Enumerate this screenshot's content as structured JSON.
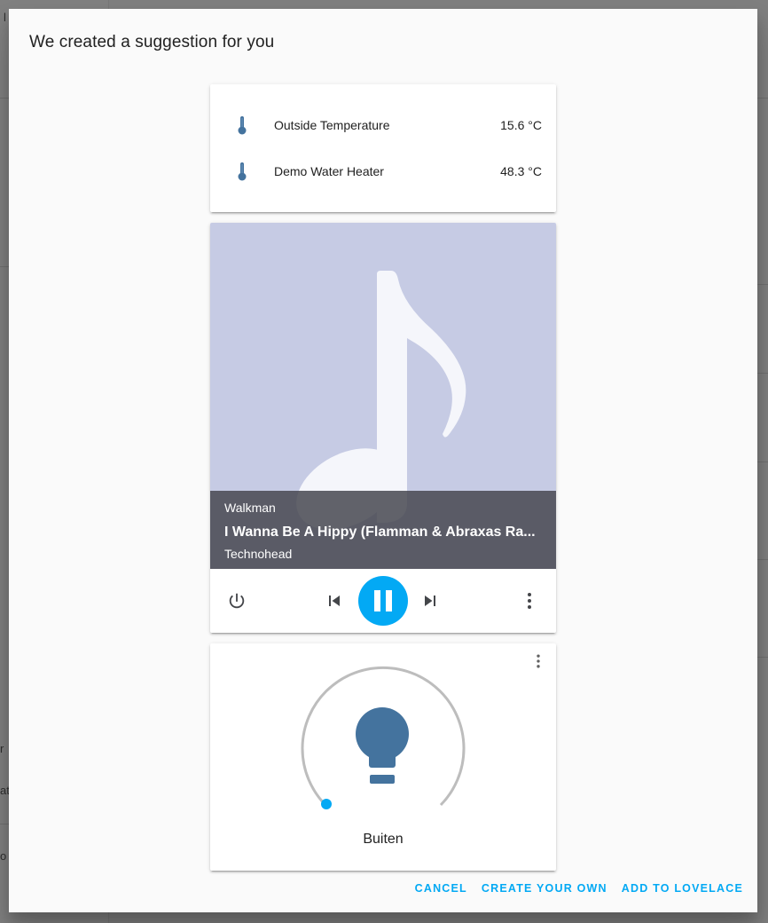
{
  "dialog": {
    "title": "We created a suggestion for you"
  },
  "entities_card": {
    "rows": [
      {
        "name": "Outside Temperature",
        "state": "15.6 °C",
        "icon": "thermometer-icon"
      },
      {
        "name": "Demo Water Heater",
        "state": "48.3 °C",
        "icon": "thermometer-icon"
      }
    ]
  },
  "media_card": {
    "player_name": "Walkman",
    "track_title": "I Wanna Be A Hippy (Flamman & Abraxas Ra...",
    "artist": "Technohead",
    "artwork_icon": "music-note-icon",
    "state": "playing",
    "controls": {
      "power_icon": "power-icon",
      "previous_icon": "skip-previous-icon",
      "pause_icon": "pause-icon",
      "next_icon": "skip-next-icon",
      "more_icon": "more-vertical-icon"
    },
    "colors": {
      "artwork_bg": "#c6cbe4",
      "accent": "#03a9f4"
    }
  },
  "light_card": {
    "name": "Buiten",
    "icon": "lightbulb-icon",
    "menu_icon": "more-vertical-icon",
    "brightness_fraction": 0,
    "colors": {
      "icon": "#44739e",
      "slider_track": "#bdbdbd",
      "slider_handle": "#03a9f4"
    }
  },
  "actions": {
    "cancel": "CANCEL",
    "create_your_own": "CREATE YOUR OWN",
    "add_to_lovelace": "ADD TO LOVELACE"
  },
  "background_fragments": [
    "l",
    "r",
    "ati",
    "o"
  ]
}
